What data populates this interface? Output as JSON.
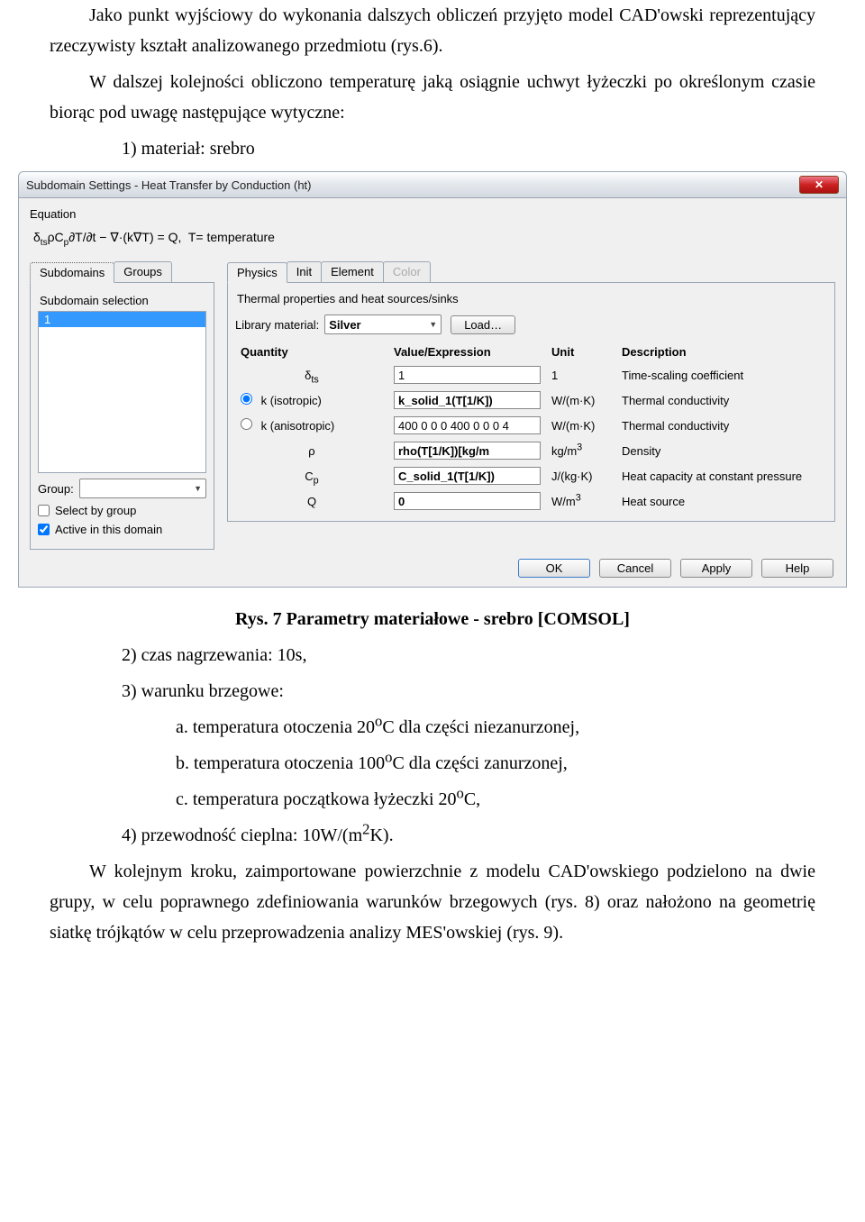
{
  "doc": {
    "p1": "Jako punkt wyjściowy do wykonania dalszych obliczeń przyjęto model CAD'owski reprezentujący rzeczywisty kształt analizowanego przedmiotu (rys.6).",
    "p2": "W dalszej kolejności obliczono temperaturę jaką osiągnie uchwyt łyżeczki po określonym czasie biorąc pod uwagę następujące wytyczne:",
    "li1": "1)  materiał: srebro",
    "caption": "Rys. 7 Parametry materiałowe - srebro [COMSOL]",
    "li2": "2)  czas nagrzewania: 10s,",
    "li3": "3)  warunku brzegowe:",
    "lia": "a.  temperatura otoczenia 20",
    "lia_tail": "C dla części niezanurzonej,",
    "lib": "b.  temperatura otoczenia 100",
    "lib_tail": "C dla części zanurzonej,",
    "lic": "c.  temperatura początkowa łyżeczki 20",
    "lic_tail": "C,",
    "li4_a": "4)  przewodność cieplna: 10W/(m",
    "li4_b": "K).",
    "p3": "W kolejnym kroku, zaimportowane powierzchnie z modelu CAD'owskiego podzielono na dwie grupy, w celu poprawnego zdefiniowania warunków brzegowych (rys. 8) oraz nałożono na geometrię siatkę trójkątów w celu przeprowadzenia analizy MES'owskiej (rys. 9)."
  },
  "dialog": {
    "title": "Subdomain Settings - Heat Transfer by Conduction (ht)",
    "equation_label": "Equation",
    "equation": "δtsρCp∂T/∂t − ∇·(k∇T) = Q,  T= temperature",
    "left_tabs": {
      "t0": "Subdomains",
      "t1": "Groups"
    },
    "subdomain_selection_label": "Subdomain selection",
    "subdomain_items": [
      "1"
    ],
    "group_label": "Group:",
    "select_by_group": "Select by group",
    "active_in_domain": "Active in this domain",
    "right_tabs": {
      "t0": "Physics",
      "t1": "Init",
      "t2": "Element",
      "t3": "Color"
    },
    "right_section_title": "Thermal properties and heat sources/sinks",
    "library_label": "Library material:",
    "library_selected": "Silver",
    "load_btn": "Load…",
    "header": {
      "qty": "Quantity",
      "val": "Value/Expression",
      "unit": "Unit",
      "desc": "Description"
    },
    "rows": [
      {
        "qty": "δts",
        "val": "1",
        "unit": "1",
        "desc": "Time-scaling coefficient",
        "plain_input": true
      },
      {
        "qty": "k (isotropic)",
        "val": "k_solid_1(T[1/K])",
        "unit": "W/(m·K)",
        "desc": "Thermal conductivity",
        "radio": true,
        "radio_checked": true
      },
      {
        "qty": "k (anisotropic)",
        "val": "400 0 0 0 400 0 0 0 4",
        "unit": "W/(m·K)",
        "desc": "Thermal conductivity",
        "radio": true,
        "plain_input": true
      },
      {
        "qty": "ρ",
        "val": "rho(T[1/K])[kg/m",
        "unit": "kg/m3",
        "desc": "Density"
      },
      {
        "qty": "Cp",
        "val": "C_solid_1(T[1/K])",
        "unit": "J/(kg·K)",
        "desc": "Heat capacity at constant pressure"
      },
      {
        "qty": "Q",
        "val": "0",
        "unit": "W/m3",
        "desc": "Heat source"
      }
    ],
    "buttons": {
      "ok": "OK",
      "cancel": "Cancel",
      "apply": "Apply",
      "help": "Help"
    }
  }
}
